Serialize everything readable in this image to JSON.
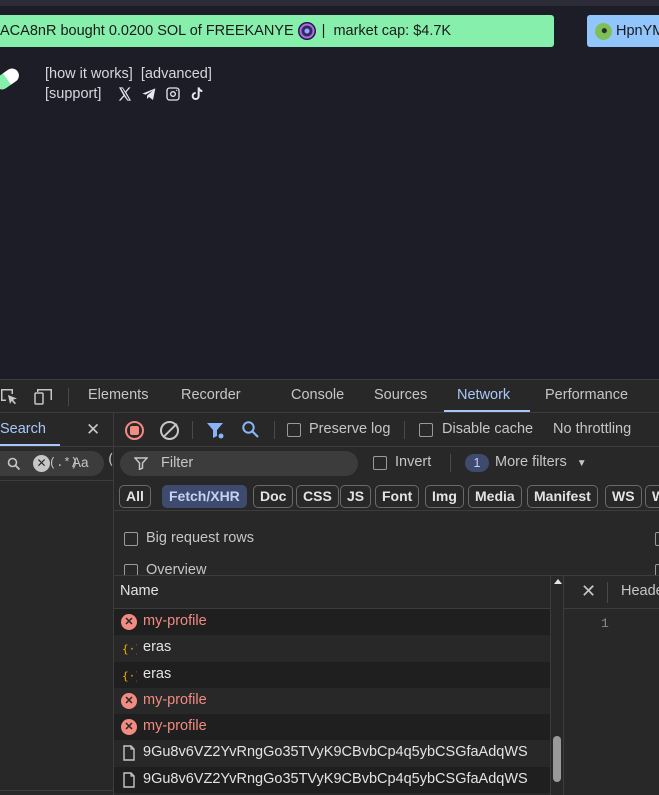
{
  "site": {
    "ticker_main": {
      "text": "ACA8nR bought 0.0200 SOL of FREEKANYE",
      "separator": "|",
      "market_cap": "market cap: $4.7K"
    },
    "ticker_side": {
      "text": "HpnYM"
    },
    "links": {
      "how_it_works": "[how it works]",
      "advanced": "[advanced]",
      "support": "[support]"
    },
    "social_icons": [
      "x-icon",
      "telegram-icon",
      "instagram-icon",
      "tiktok-icon"
    ],
    "colors": {
      "background": "#1d1d28",
      "ticker_green": "#86efac",
      "ticker_blue": "#93c5fd"
    }
  },
  "devtools": {
    "tabs": [
      "Elements",
      "Recorder",
      "Console",
      "Sources",
      "Network",
      "Performance"
    ],
    "active_tab": "Network",
    "search": {
      "title": "Search",
      "regex_label": ".*",
      "case_label": "Aa"
    },
    "network": {
      "preserve_log": "Preserve log",
      "disable_cache": "Disable cache",
      "throttling": "No throttling",
      "filter_placeholder": "Filter",
      "invert": "Invert",
      "more_filters_count": "1",
      "more_filters": "More filters",
      "types": [
        "All",
        "Fetch/XHR",
        "Doc",
        "CSS",
        "JS",
        "Font",
        "Img",
        "Media",
        "Manifest",
        "WS",
        "W"
      ],
      "active_type": "Fetch/XHR",
      "big_request_rows": "Big request rows",
      "overview": "Overview",
      "column_name": "Name",
      "requests": [
        {
          "name": "my-profile",
          "status": "error"
        },
        {
          "name": "eras",
          "status": "json"
        },
        {
          "name": "eras",
          "status": "json"
        },
        {
          "name": "my-profile",
          "status": "error"
        },
        {
          "name": "my-profile",
          "status": "error"
        },
        {
          "name": "9Gu8v6VZ2YvRngGo35TVyK9CBvbCp4q5ybCSGfaAdqWS",
          "status": "document"
        },
        {
          "name": "9Gu8v6VZ2YvRngGo35TVyK9CBvbCp4q5ybCSGfaAdqWS",
          "status": "document"
        }
      ],
      "detail_tab": "Heade",
      "detail_line": "1"
    }
  }
}
